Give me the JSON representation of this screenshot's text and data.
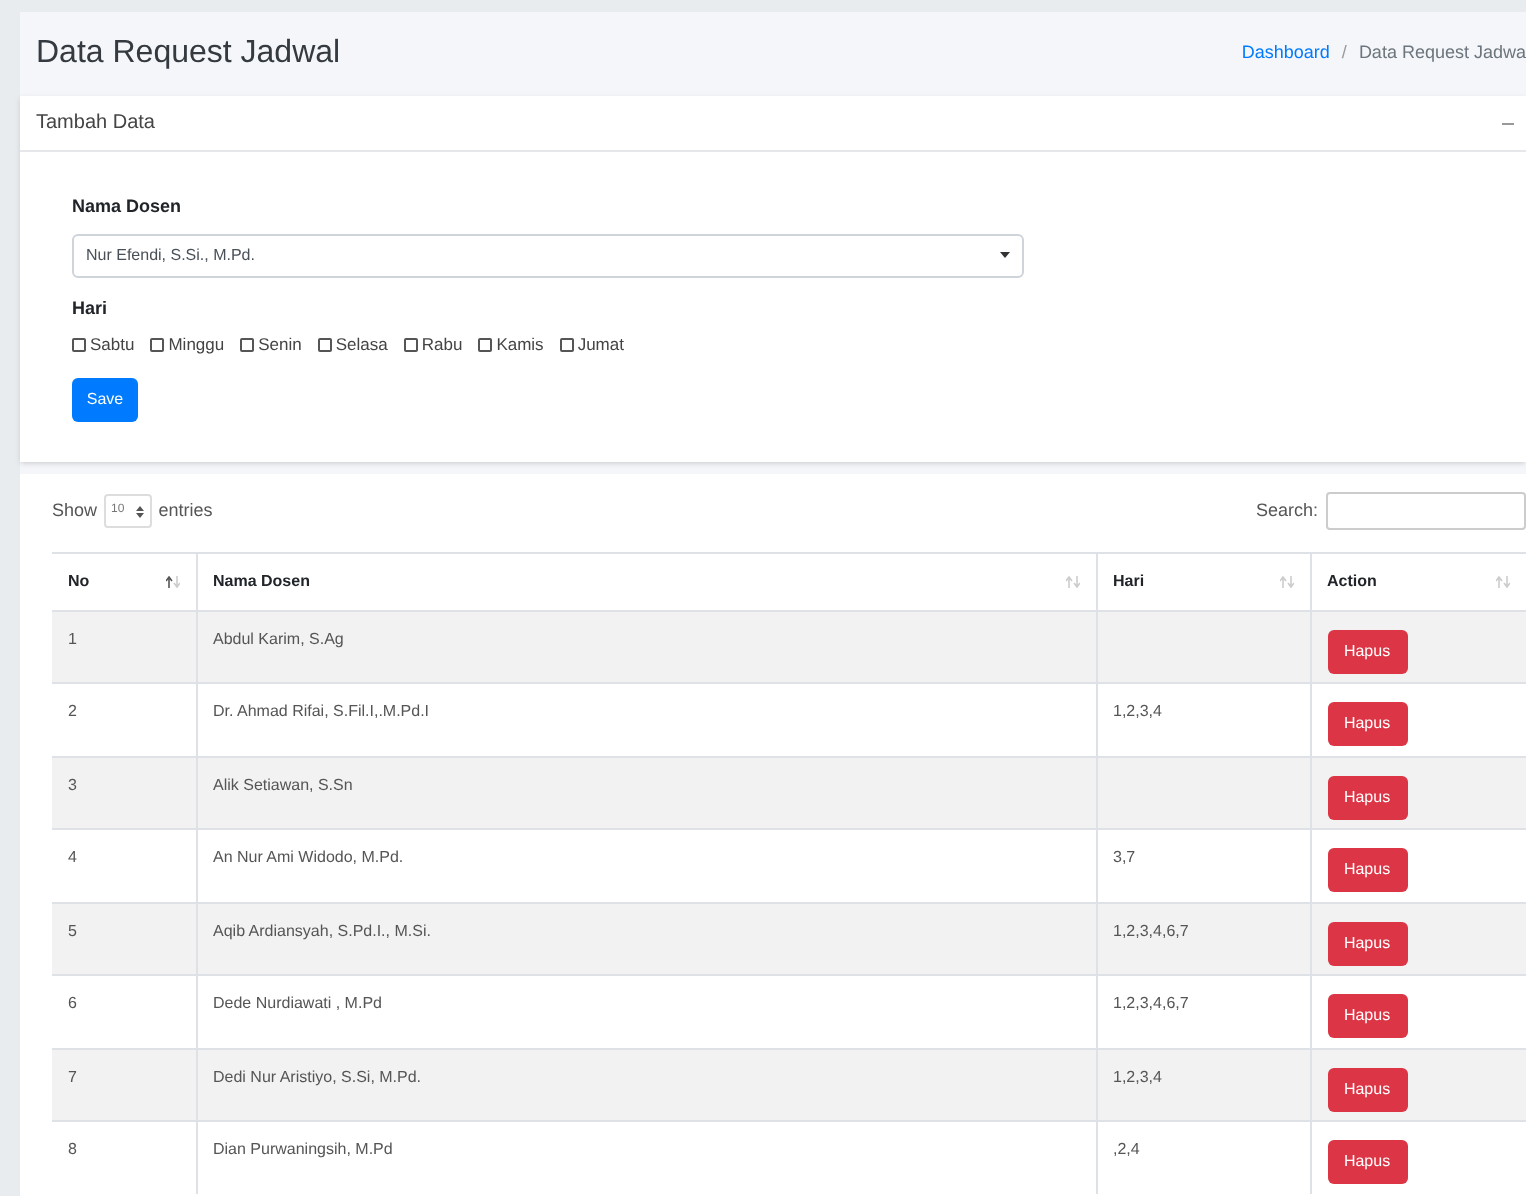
{
  "page_title": "Data Request Jadwal",
  "breadcrumb": [
    {
      "label": "Dashboard",
      "kind": "link"
    },
    {
      "separator": "/",
      "label": "Data Request Jadwa",
      "kind": "current"
    }
  ],
  "form_card": {
    "title": "Tambah Data",
    "dosen_label": "Nama Dosen",
    "dosen_value": "Nur Efendi, S.Si., M.Pd.",
    "hari_label": "Hari",
    "days": [
      {
        "label": "Sabtu",
        "checked": false
      },
      {
        "label": "Minggu",
        "checked": false
      },
      {
        "label": "Senin",
        "checked": false
      },
      {
        "label": "Selasa",
        "checked": false
      },
      {
        "label": "Rabu",
        "checked": false
      },
      {
        "label": "Kamis",
        "checked": false
      },
      {
        "label": "Jumat",
        "checked": false
      }
    ],
    "save_button": "Save"
  },
  "table_card": {
    "show_label": "Show",
    "page_size": "10",
    "entries_label": "entries",
    "search_label": "Search:",
    "columns": [
      {
        "label": "No",
        "sorted": true
      },
      {
        "label": "Nama Dosen",
        "sorted": false
      },
      {
        "label": "Hari",
        "sorted": false
      },
      {
        "label": "Action",
        "sorted": false
      }
    ],
    "rows": [
      {
        "no": "1",
        "nama": "Abdul Karim, S.Ag",
        "hari": "",
        "action": "Hapus"
      },
      {
        "no": "2",
        "nama": "Dr. Ahmad Rifai, S.Fil.I,.M.Pd.I",
        "hari": "1,2,3,4",
        "action": "Hapus"
      },
      {
        "no": "3",
        "nama": "Alik Setiawan, S.Sn",
        "hari": "",
        "action": "Hapus"
      },
      {
        "no": "4",
        "nama": "An Nur Ami Widodo, M.Pd.",
        "hari": "3,7",
        "action": "Hapus"
      },
      {
        "no": "5",
        "nama": "Aqib Ardiansyah, S.Pd.I., M.Si.",
        "hari": "1,2,3,4,6,7",
        "action": "Hapus"
      },
      {
        "no": "6",
        "nama": "Dede Nurdiawati , M.Pd",
        "hari": "1,2,3,4,6,7",
        "action": "Hapus"
      },
      {
        "no": "7",
        "nama": "Dedi Nur Aristiyo, S.Si, M.Pd.",
        "hari": "1,2,3,4",
        "action": "Hapus"
      },
      {
        "no": "8",
        "nama": "Dian Purwaningsih, M.Pd",
        "hari": ",2,4",
        "action": "Hapus"
      }
    ]
  }
}
